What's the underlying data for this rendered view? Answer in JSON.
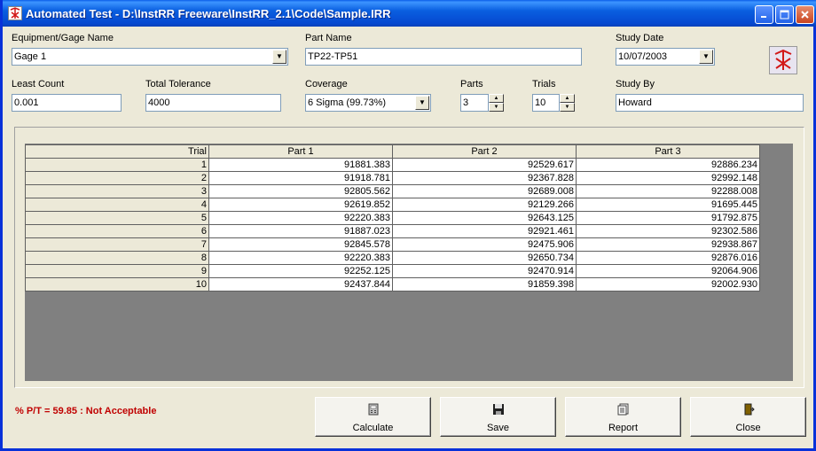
{
  "window": {
    "title": "Automated Test - D:\\InstRR Freeware\\InstRR_2.1\\Code\\Sample.IRR",
    "controls": [
      "minimize-icon",
      "maximize-icon",
      "close-icon"
    ]
  },
  "form": {
    "equipment_label": "Equipment/Gage Name",
    "equipment_value": "Gage 1",
    "part_name_label": "Part Name",
    "part_name_value": "TP22-TP51",
    "study_date_label": "Study Date",
    "study_date_value": "10/07/2003",
    "least_count_label": "Least Count",
    "least_count_value": "0.001",
    "total_tolerance_label": "Total Tolerance",
    "total_tolerance_value": "4000",
    "coverage_label": "Coverage",
    "coverage_value": "6 Sigma (99.73%)",
    "parts_label": "Parts",
    "parts_value": "3",
    "trials_label": "Trials",
    "trials_value": "10",
    "study_by_label": "Study By",
    "study_by_value": "Howard"
  },
  "grid": {
    "headers": [
      "Trial",
      "Part 1",
      "Part 2",
      "Part 3"
    ],
    "rows": [
      [
        "1",
        "91881.383",
        "92529.617",
        "92886.234"
      ],
      [
        "2",
        "91918.781",
        "92367.828",
        "92992.148"
      ],
      [
        "3",
        "92805.562",
        "92689.008",
        "92288.008"
      ],
      [
        "4",
        "92619.852",
        "92129.266",
        "91695.445"
      ],
      [
        "5",
        "92220.383",
        "92643.125",
        "91792.875"
      ],
      [
        "6",
        "91887.023",
        "92921.461",
        "92302.586"
      ],
      [
        "7",
        "92845.578",
        "92475.906",
        "92938.867"
      ],
      [
        "8",
        "92220.383",
        "92650.734",
        "92876.016"
      ],
      [
        "9",
        "92252.125",
        "92470.914",
        "92064.906"
      ],
      [
        "10",
        "92437.844",
        "91859.398",
        "92002.930"
      ]
    ]
  },
  "status": {
    "text": "% P/T = 59.85 : Not Acceptable",
    "color": "#c00000"
  },
  "buttons": {
    "calculate": "Calculate",
    "save": "Save",
    "report": "Report",
    "close": "Close"
  },
  "colors": {
    "titlebar": "#0a5fe0",
    "face": "#ece9d8",
    "grid_background": "#808080"
  }
}
